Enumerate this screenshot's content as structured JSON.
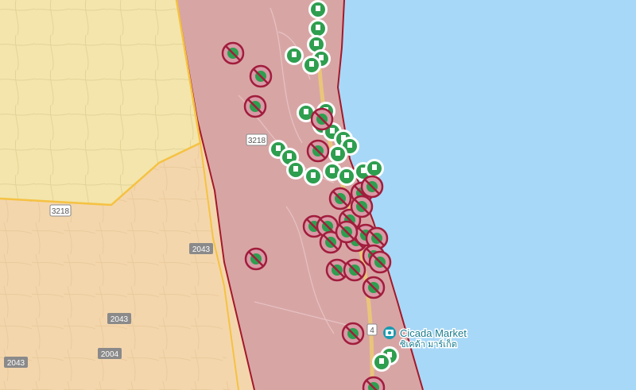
{
  "map": {
    "place_labels": {
      "cicada_market": "Cicada Market",
      "cicada_market_thai": "ซิเคด้า มาร์เก็ต"
    },
    "road_labels": [
      {
        "id": "road-3218-north",
        "text": "3218"
      },
      {
        "id": "road-3218-west",
        "text": "3218"
      },
      {
        "id": "road-2043-east",
        "text": "2043"
      },
      {
        "id": "road-2043-mid",
        "text": "2043"
      },
      {
        "id": "road-2004",
        "text": "2004"
      },
      {
        "id": "road-2043-southwest",
        "text": "2043"
      },
      {
        "id": "road-4",
        "text": "4"
      }
    ],
    "colors": {
      "sea": "#a8d8f7",
      "highlight_zone": "#d8a5a5",
      "zone_border": "#a3182a",
      "province_yellow": "#f3e5ab",
      "province_orange": "#f4d6ad",
      "boundary": "#f5c242",
      "green_marker": "#2e9e4f",
      "red_marker_ring": "#a11d3c",
      "road_badge": "#8a8a8a"
    },
    "markers": {
      "green_icon": "covid-vaccine-green-marker-icon",
      "red_icon": "covid-prohibited-red-marker-icon",
      "poi_icon": "camera-poi-icon"
    }
  }
}
